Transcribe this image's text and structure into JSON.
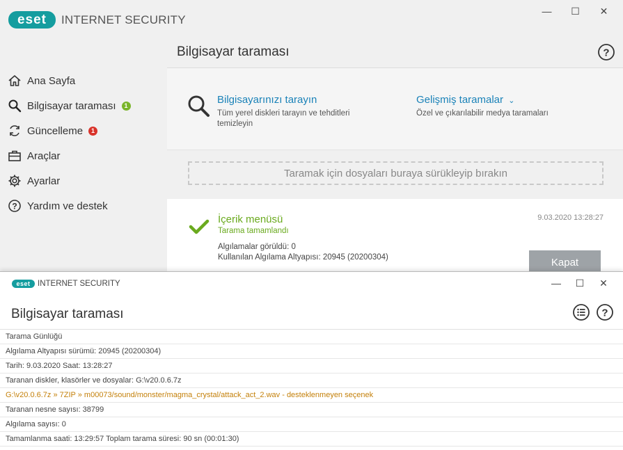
{
  "app": {
    "brand": "eset",
    "product": "INTERNET SECURITY"
  },
  "colors": {
    "accent": "#159d9f",
    "link": "#1a82b8",
    "success": "#6aaa1e",
    "warning": "#c4800a",
    "badge_green": "#7ab52b",
    "badge_red": "#d9332a"
  },
  "back_window": {
    "page_title": "Bilgisayar taraması",
    "sidebar": [
      {
        "label": "Ana Sayfa",
        "icon": "home-icon",
        "badge": null
      },
      {
        "label": "Bilgisayar taraması",
        "icon": "search-icon",
        "badge": "1"
      },
      {
        "label": "Güncelleme",
        "icon": "refresh-icon",
        "badge": "1"
      },
      {
        "label": "Araçlar",
        "icon": "toolbox-icon",
        "badge": null
      },
      {
        "label": "Ayarlar",
        "icon": "gear-icon",
        "badge": null
      },
      {
        "label": "Yardım ve destek",
        "icon": "help-circle-icon",
        "badge": null
      }
    ],
    "scan_computer": {
      "title": "Bilgisayarınızı tarayın",
      "desc1": "Tüm yerel diskleri tarayın ve tehditleri",
      "desc2": "temizleyin"
    },
    "advanced_scans": {
      "title": "Gelişmiş taramalar",
      "desc": "Özel ve çıkarılabilir medya taramaları"
    },
    "dropzone": "Taramak için dosyaları buraya sürükleyip bırakın",
    "result": {
      "title": "İçerik menüsü",
      "status": "Tarama tamamlandı",
      "line1": "Algılamalar görüldü: 0",
      "line2": "Kullanılan Algılama Altyapısı: 20945 (20200304)",
      "date": "9.03.2020 13:28:27"
    },
    "close_button": "Kapat"
  },
  "front_window": {
    "page_title": "Bilgisayar taraması",
    "log": [
      {
        "text": "Tarama Günlüğü",
        "warn": false
      },
      {
        "text": "Algılama Altyapısı sürümü: 20945 (20200304)",
        "warn": false
      },
      {
        "text": "Tarih: 9.03.2020  Saat: 13:28:27",
        "warn": false
      },
      {
        "text": "Taranan diskler, klasörler ve dosyalar: G:\\v20.0.6.7z",
        "warn": false
      },
      {
        "text": "G:\\v20.0.6.7z » 7ZIP » m00073/sound/monster/magma_crystal/attack_act_2.wav - desteklenmeyen seçenek",
        "warn": true
      },
      {
        "text": "Taranan nesne sayısı: 38799",
        "warn": false
      },
      {
        "text": "Algılama sayısı: 0",
        "warn": false
      },
      {
        "text": "Tamamlanma saati: 13:29:57  Toplam tarama süresi: 90 sn (00:01:30)",
        "warn": false
      }
    ]
  }
}
